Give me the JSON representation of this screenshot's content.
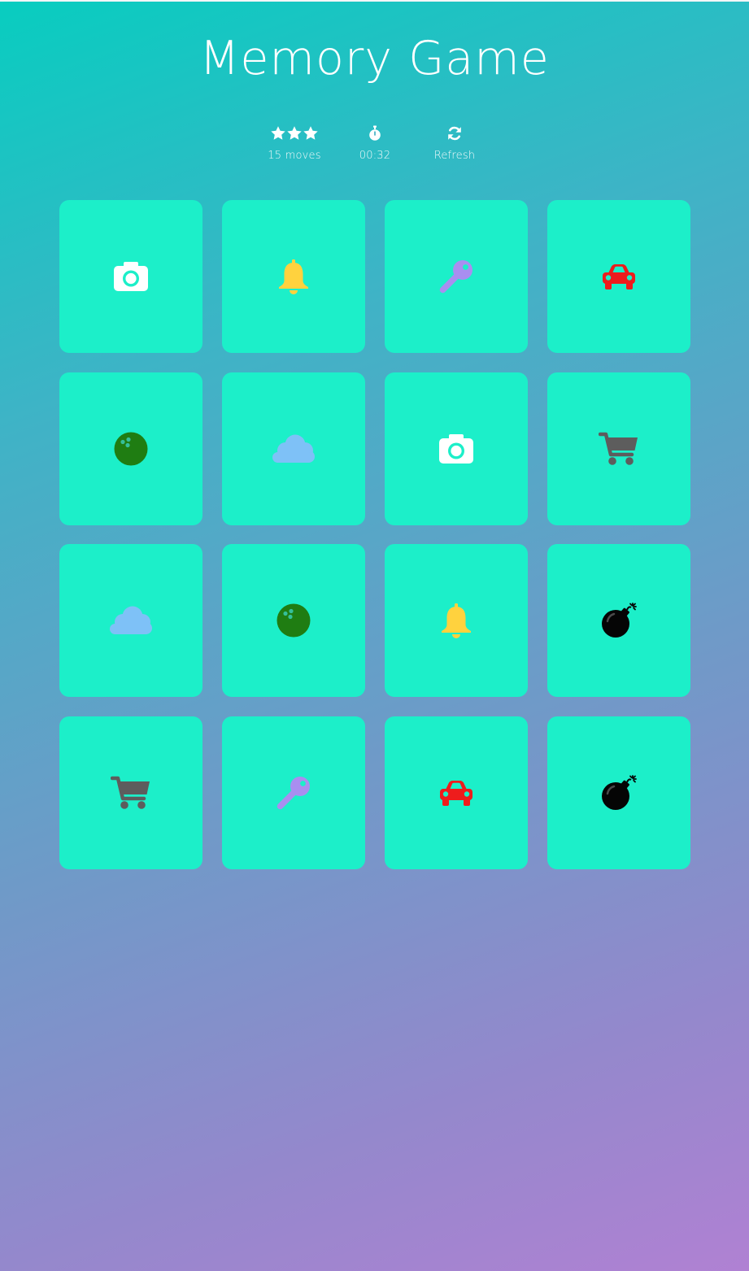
{
  "title": "Memory Game",
  "score_panel": {
    "stars_count": 3,
    "moves_label": "15 moves",
    "timer_label": "00:32",
    "refresh_label": "Refresh"
  },
  "colors": {
    "card_background": "#1cefc9",
    "camera": "#ffffff",
    "bell": "#ffd23e",
    "key": "#a98ef0",
    "car": "#ee1c1c",
    "bowling": "#1f7d12",
    "cloud": "#7ec1f7",
    "cart": "#5d5d5d",
    "bomb": "#050505"
  },
  "cards": [
    {
      "icon": "camera"
    },
    {
      "icon": "bell"
    },
    {
      "icon": "key"
    },
    {
      "icon": "car"
    },
    {
      "icon": "bowling-ball"
    },
    {
      "icon": "cloud"
    },
    {
      "icon": "camera"
    },
    {
      "icon": "shopping-cart"
    },
    {
      "icon": "cloud"
    },
    {
      "icon": "bowling-ball"
    },
    {
      "icon": "bell"
    },
    {
      "icon": "bomb"
    },
    {
      "icon": "shopping-cart"
    },
    {
      "icon": "key"
    },
    {
      "icon": "car"
    },
    {
      "icon": "bomb"
    }
  ]
}
